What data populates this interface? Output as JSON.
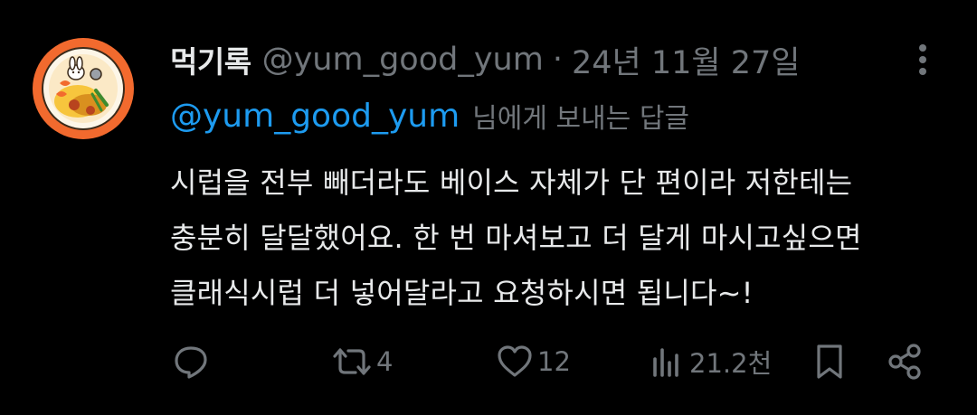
{
  "tweet": {
    "display_name": "먹기록",
    "handle": "@yum_good_yum",
    "separator": "·",
    "date": "24년 11월 27일",
    "reply_to_handle": "@yum_good_yum",
    "reply_to_suffix": "님에게 보내는 답글",
    "body_lines": [
      "시럽을 전부 빼더라도 베이스 자체가 단 편이라 저한테는",
      "충분히 달달했어요. 한 번 마셔보고 더 달게 마시고싶으면",
      "클래식시럽 더 넣어달라고 요청하시면 됩니다~!"
    ]
  },
  "actions": {
    "reply_count": "",
    "retweet_count": "4",
    "like_count": "12",
    "views_count": "21.2천"
  },
  "icons": {
    "avatar": "food-plate-avatar",
    "more": "more-vertical-icon",
    "reply": "reply-bubble-icon",
    "retweet": "retweet-icon",
    "like": "heart-icon",
    "views": "views-bar-icon",
    "bookmark": "bookmark-icon",
    "share": "share-icon"
  },
  "colors": {
    "background": "#000000",
    "text": "#e7e9ea",
    "muted": "#71767b",
    "link": "#1d9bf0",
    "avatar_ring": "#f26a2e"
  }
}
